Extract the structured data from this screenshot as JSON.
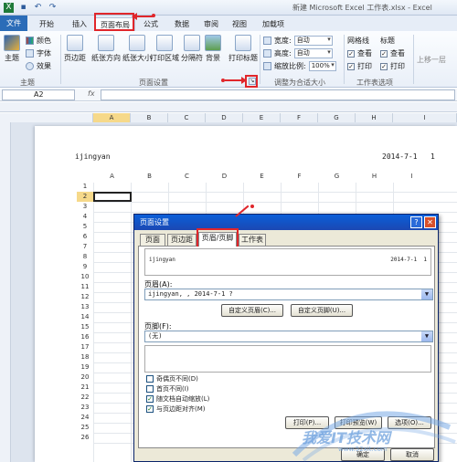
{
  "window": {
    "title": "新建 Microsoft Excel 工作表.xlsx - Excel"
  },
  "tabs": [
    {
      "label": "文件"
    },
    {
      "label": "开始"
    },
    {
      "label": "插入"
    },
    {
      "label": "页面布局"
    },
    {
      "label": "公式"
    },
    {
      "label": "数据"
    },
    {
      "label": "审阅"
    },
    {
      "label": "视图"
    },
    {
      "label": "加载项"
    }
  ],
  "ribbon": {
    "theme": {
      "main": "主题",
      "colors": "颜色",
      "fonts": "字体",
      "effects": "效果"
    },
    "page_setup": {
      "margins": "页边距",
      "orientation": "纸张方向",
      "size": "纸张大小",
      "print_area": "打印区域",
      "breaks": "分隔符",
      "background": "背景",
      "print_titles": "打印标题",
      "label": "页面设置"
    },
    "scale": {
      "width_label": "宽度:",
      "width_value": "自动",
      "height_label": "高度:",
      "height_value": "自动",
      "scale_label": "缩放比例:",
      "scale_value": "100%",
      "label": "调整为合适大小"
    },
    "sheet_options": {
      "gridlines": "网格线",
      "headings": "标题",
      "view": "查看",
      "print": "打印",
      "label": "工作表选项"
    },
    "arrange": {
      "up": "上移一层"
    }
  },
  "formula_bar": {
    "name_box": "A2",
    "fx": "fx"
  },
  "columns": [
    "A",
    "B",
    "C",
    "D",
    "E",
    "F",
    "G",
    "H",
    "I"
  ],
  "page": {
    "header_left": "ijingyan",
    "header_right": "2014-7-1",
    "header_page": "1",
    "rows": [
      "1",
      "2",
      "3",
      "4",
      "5",
      "6",
      "7",
      "8",
      "9",
      "10",
      "11",
      "12",
      "13",
      "14",
      "15",
      "16",
      "17",
      "18",
      "19",
      "20",
      "21",
      "22",
      "23",
      "24",
      "25",
      "26"
    ]
  },
  "dialog": {
    "title": "页面设置",
    "tabs": [
      "页面",
      "页边距",
      "页眉/页脚",
      "工作表"
    ],
    "preview_left": "ijingyan",
    "preview_right": "2014-7-1",
    "preview_page": "1",
    "header_label": "页眉(A):",
    "header_value": "ijingyan, , 2014-7-1  ?",
    "custom_header": "自定义页眉(C)...",
    "custom_footer": "自定义页脚(U)...",
    "footer_label": "页脚(F):",
    "footer_value": "(无)",
    "options": [
      {
        "label": "奇偶页不同(D)",
        "checked": false
      },
      {
        "label": "首页不同(I)",
        "checked": false
      },
      {
        "label": "随文档自动缩放(L)",
        "checked": true
      },
      {
        "label": "与页边距对齐(M)",
        "checked": true
      }
    ],
    "print_btn": "打印(P)...",
    "preview_btn": "打印预览(W)",
    "options_btn": "选项(O)...",
    "ok_btn": "确定",
    "cancel_btn": "取消"
  },
  "watermark": {
    "text": "我爱IT技术网",
    "sub": "www.52xit.com"
  },
  "colors": {
    "accent": "#2b6cb8",
    "annotation": "#e0262b",
    "dialog_title": "#0a5fd8"
  }
}
